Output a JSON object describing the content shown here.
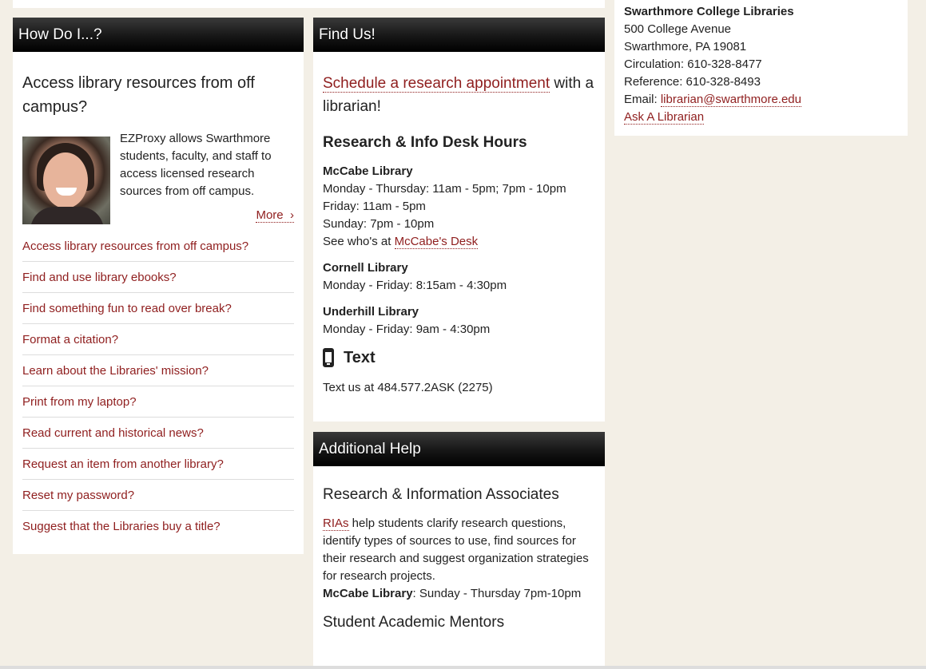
{
  "how_do_i": {
    "header": "How Do I...?",
    "feature_question": "Access library resources from off campus?",
    "feature_text": "EZProxy allows Swarthmore students, faculty, and staff to access licensed research sources from off campus.",
    "more_label": "More",
    "more_icon": "chevron-right-icon",
    "questions": [
      "Access library resources from off campus?",
      "Find and use library ebooks?",
      "Find something fun to read over break?",
      "Format a citation?",
      "Learn about the Libraries' mission?",
      "Print from my laptop?",
      "Read current and historical news?",
      "Request an item from another library?",
      "Reset my password?",
      "Suggest that the Libraries buy a title?"
    ]
  },
  "find_us": {
    "header": "Find Us!",
    "schedule_link": "Schedule a research appointment",
    "schedule_suffix": " with a librarian!",
    "hours_title": "Research & Info Desk Hours",
    "libraries": [
      {
        "name": "McCabe Library",
        "lines": [
          "Monday - Thursday: 11am - 5pm; 7pm - 10pm",
          "Friday: 11am - 5pm",
          "Sunday: 7pm - 10pm"
        ],
        "see_prefix": "See who's at ",
        "see_link": "McCabe's Desk"
      },
      {
        "name": "Cornell Library",
        "lines": [
          "Monday - Friday: 8:15am - 4:30pm"
        ]
      },
      {
        "name": "Underhill Library",
        "lines": [
          "Monday - Friday: 9am - 4:30pm"
        ]
      }
    ],
    "text_title": "Text",
    "text_icon": "mobile-phone-icon",
    "text_body": "Text us at 484.577.2ASK (2275)"
  },
  "additional_help": {
    "header": "Additional Help",
    "associates_title": "Research & Information Associates",
    "ria_link": "RIAs",
    "ria_desc": " help students clarify research questions, identify types of sources to use, find sources for their research and suggest organization strategies for research projects.",
    "ria_hours_lib": "McCabe Library",
    "ria_hours": ": Sunday - Thursday 7pm-10pm",
    "mentors_title": "Student Academic Mentors"
  },
  "address": {
    "org": "Swarthmore College Libraries",
    "street": "500 College Avenue",
    "city": "Swarthmore, PA 19081",
    "circulation": "Circulation: 610-328-8477",
    "reference": "Reference: 610-328-8493",
    "email_label": "Email: ",
    "email": "librarian@swarthmore.edu",
    "ask_link": "Ask A Librarian"
  },
  "colors": {
    "link": "#8f1e1e",
    "page_bg": "#f3efe6",
    "header_bg": "#111111"
  }
}
